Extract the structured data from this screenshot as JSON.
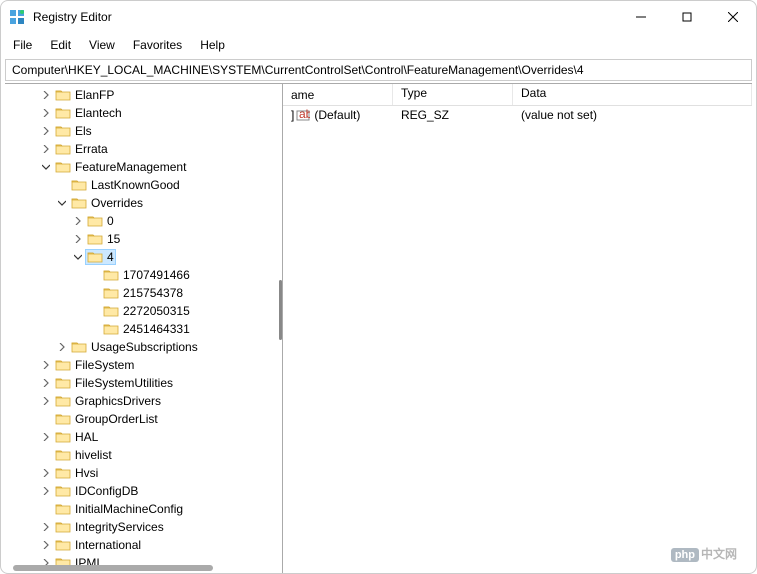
{
  "window": {
    "title": "Registry Editor"
  },
  "menu": {
    "items": [
      "File",
      "Edit",
      "View",
      "Favorites",
      "Help"
    ]
  },
  "address": "Computer\\HKEY_LOCAL_MACHINE\\SYSTEM\\CurrentControlSet\\Control\\FeatureManagement\\Overrides\\4",
  "tree": [
    {
      "indent": 2,
      "chev": "right",
      "label": "ElanFP"
    },
    {
      "indent": 2,
      "chev": "right",
      "label": "Elantech"
    },
    {
      "indent": 2,
      "chev": "right",
      "label": "Els"
    },
    {
      "indent": 2,
      "chev": "right",
      "label": "Errata"
    },
    {
      "indent": 2,
      "chev": "down",
      "label": "FeatureManagement"
    },
    {
      "indent": 3,
      "chev": "none",
      "label": "LastKnownGood"
    },
    {
      "indent": 3,
      "chev": "down",
      "label": "Overrides"
    },
    {
      "indent": 4,
      "chev": "right",
      "label": "0"
    },
    {
      "indent": 4,
      "chev": "right",
      "label": "15"
    },
    {
      "indent": 4,
      "chev": "down",
      "label": "4",
      "selected": true
    },
    {
      "indent": 5,
      "chev": "none",
      "label": "1707491466"
    },
    {
      "indent": 5,
      "chev": "none",
      "label": "215754378"
    },
    {
      "indent": 5,
      "chev": "none",
      "label": "2272050315"
    },
    {
      "indent": 5,
      "chev": "none",
      "label": "2451464331"
    },
    {
      "indent": 3,
      "chev": "right",
      "label": "UsageSubscriptions"
    },
    {
      "indent": 2,
      "chev": "right",
      "label": "FileSystem"
    },
    {
      "indent": 2,
      "chev": "right",
      "label": "FileSystemUtilities"
    },
    {
      "indent": 2,
      "chev": "right",
      "label": "GraphicsDrivers"
    },
    {
      "indent": 2,
      "chev": "none",
      "label": "GroupOrderList"
    },
    {
      "indent": 2,
      "chev": "right",
      "label": "HAL"
    },
    {
      "indent": 2,
      "chev": "none",
      "label": "hivelist"
    },
    {
      "indent": 2,
      "chev": "right",
      "label": "Hvsi"
    },
    {
      "indent": 2,
      "chev": "right",
      "label": "IDConfigDB"
    },
    {
      "indent": 2,
      "chev": "none",
      "label": "InitialMachineConfig"
    },
    {
      "indent": 2,
      "chev": "right",
      "label": "IntegrityServices"
    },
    {
      "indent": 2,
      "chev": "right",
      "label": "International"
    },
    {
      "indent": 2,
      "chev": "right",
      "label": "IPMI"
    }
  ],
  "list": {
    "columns": {
      "name": "ame",
      "type": "Type",
      "data": "Data"
    },
    "rows": [
      {
        "name": "(Default)",
        "name_prefix": "]",
        "type": "REG_SZ",
        "data": "(value not set)"
      }
    ]
  },
  "watermark": {
    "badge": "php",
    "text": "中文网"
  }
}
